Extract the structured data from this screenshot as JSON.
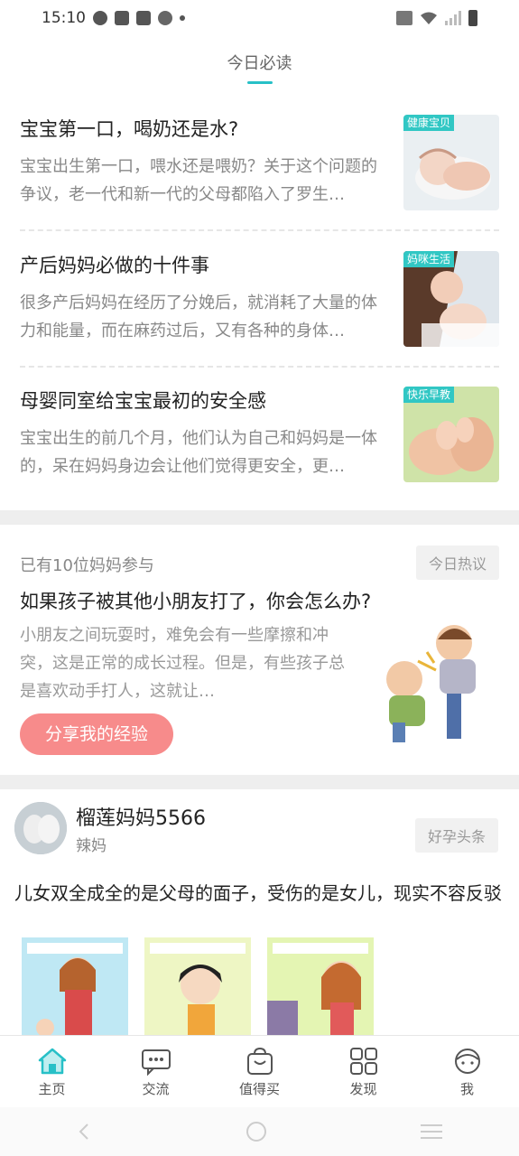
{
  "status_bar": {
    "time": "15:10"
  },
  "section": {
    "title": "今日必读"
  },
  "articles": [
    {
      "title": "宝宝第一口，喝奶还是水?",
      "desc": "宝宝出生第一口，喂水还是喂奶？关于这个问题的争议，老一代和新一代的父母都陷入了罗生…",
      "tag": "健康宝贝"
    },
    {
      "title": "产后妈妈必做的十件事",
      "desc": "很多产后妈妈在经历了分娩后，就消耗了大量的体力和能量，而在麻药过后，又有各种的身体…",
      "tag": "妈咪生活"
    },
    {
      "title": "母婴同室给宝宝最初的安全感",
      "desc": "宝宝出生的前几个月，他们认为自己和妈妈是一体的，呆在妈妈身边会让他们觉得更安全，更…",
      "tag": "快乐早教"
    }
  ],
  "discussion": {
    "participants": "已有10位妈妈参与",
    "badge": "今日热议",
    "question": "如果孩子被其他小朋友打了，你会怎么办?",
    "desc": "小朋友之间玩耍时，难免会有一些摩擦和冲突，这是正常的成长过程。但是，有些孩子总是喜欢动手打人，这就让…",
    "share_label": "分享我的经验"
  },
  "post": {
    "username": "榴莲妈妈5566",
    "role": "辣妈",
    "badge": "好孕头条",
    "headline": "儿女双全成全的是父母的面子，受伤的是女儿，现实不容反驳"
  },
  "tabs": [
    {
      "label": "主页",
      "icon": "home-icon"
    },
    {
      "label": "交流",
      "icon": "chat-icon"
    },
    {
      "label": "值得买",
      "icon": "shopping-bag-icon"
    },
    {
      "label": "发现",
      "icon": "discover-icon"
    },
    {
      "label": "我",
      "icon": "profile-icon"
    }
  ],
  "colors": {
    "accent": "#27c0c7",
    "share_button": "#f78b8b",
    "tab_active": "#27c0c7"
  }
}
